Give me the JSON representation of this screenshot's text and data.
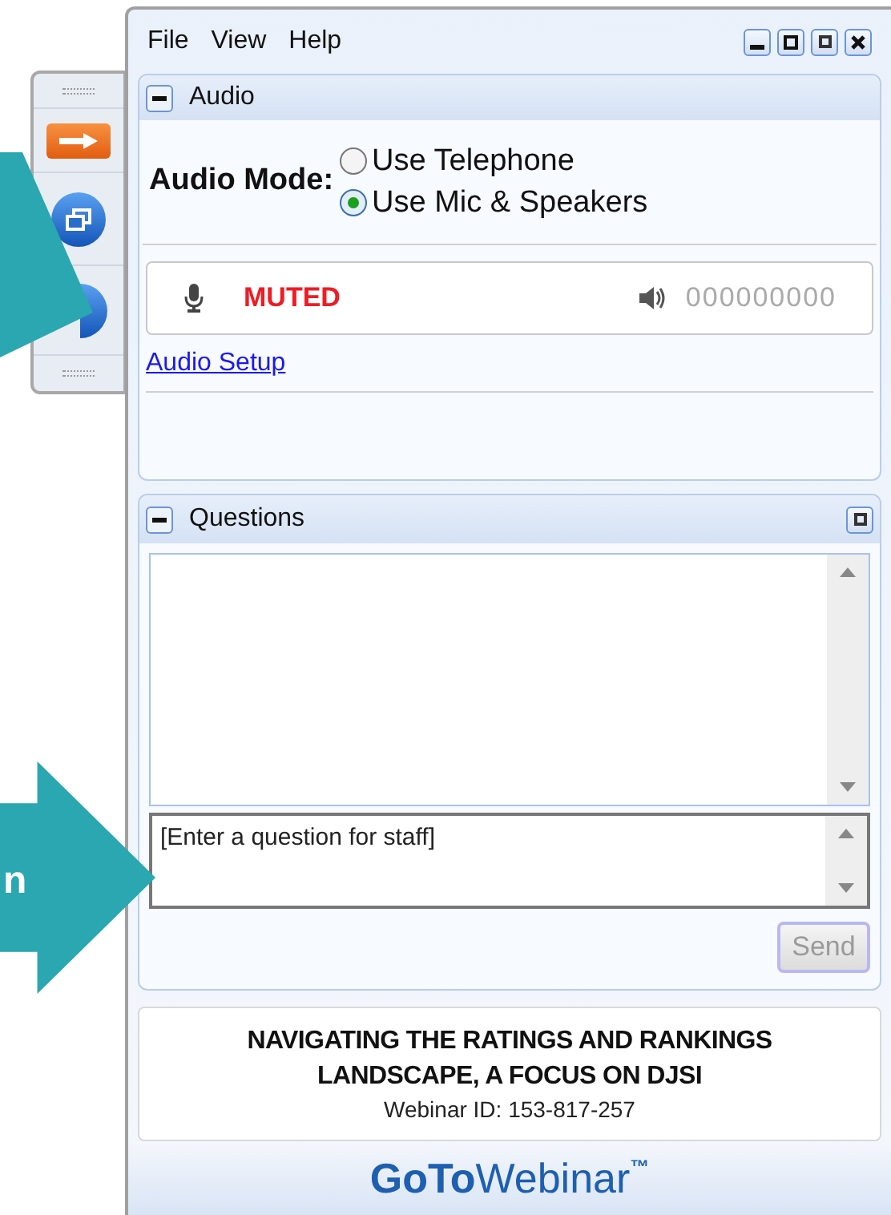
{
  "menu": [
    "File",
    "View",
    "Help"
  ],
  "audio": {
    "title": "Audio",
    "mode_label": "Audio Mode:",
    "options": [
      {
        "label": "Use Telephone",
        "selected": false
      },
      {
        "label": "Use Mic & Speakers",
        "selected": true
      }
    ],
    "mic_status": "MUTED",
    "speaker_level": "000000000",
    "setup_link": "Audio Setup"
  },
  "questions": {
    "title": "Questions",
    "input": {
      "value": "[Enter a question for staff]"
    },
    "send": {
      "label": "Send",
      "disabled": true
    }
  },
  "info": {
    "title": "NAVIGATING THE RATINGS AND RANKINGS LANDSCAPE, A FOCUS ON DJSI",
    "webinar_id": "Webinar ID: 153-817-257"
  },
  "logo": {
    "bold": "GoTo",
    "light": "Webinar",
    "mark": "™"
  },
  "callout_text": "n"
}
